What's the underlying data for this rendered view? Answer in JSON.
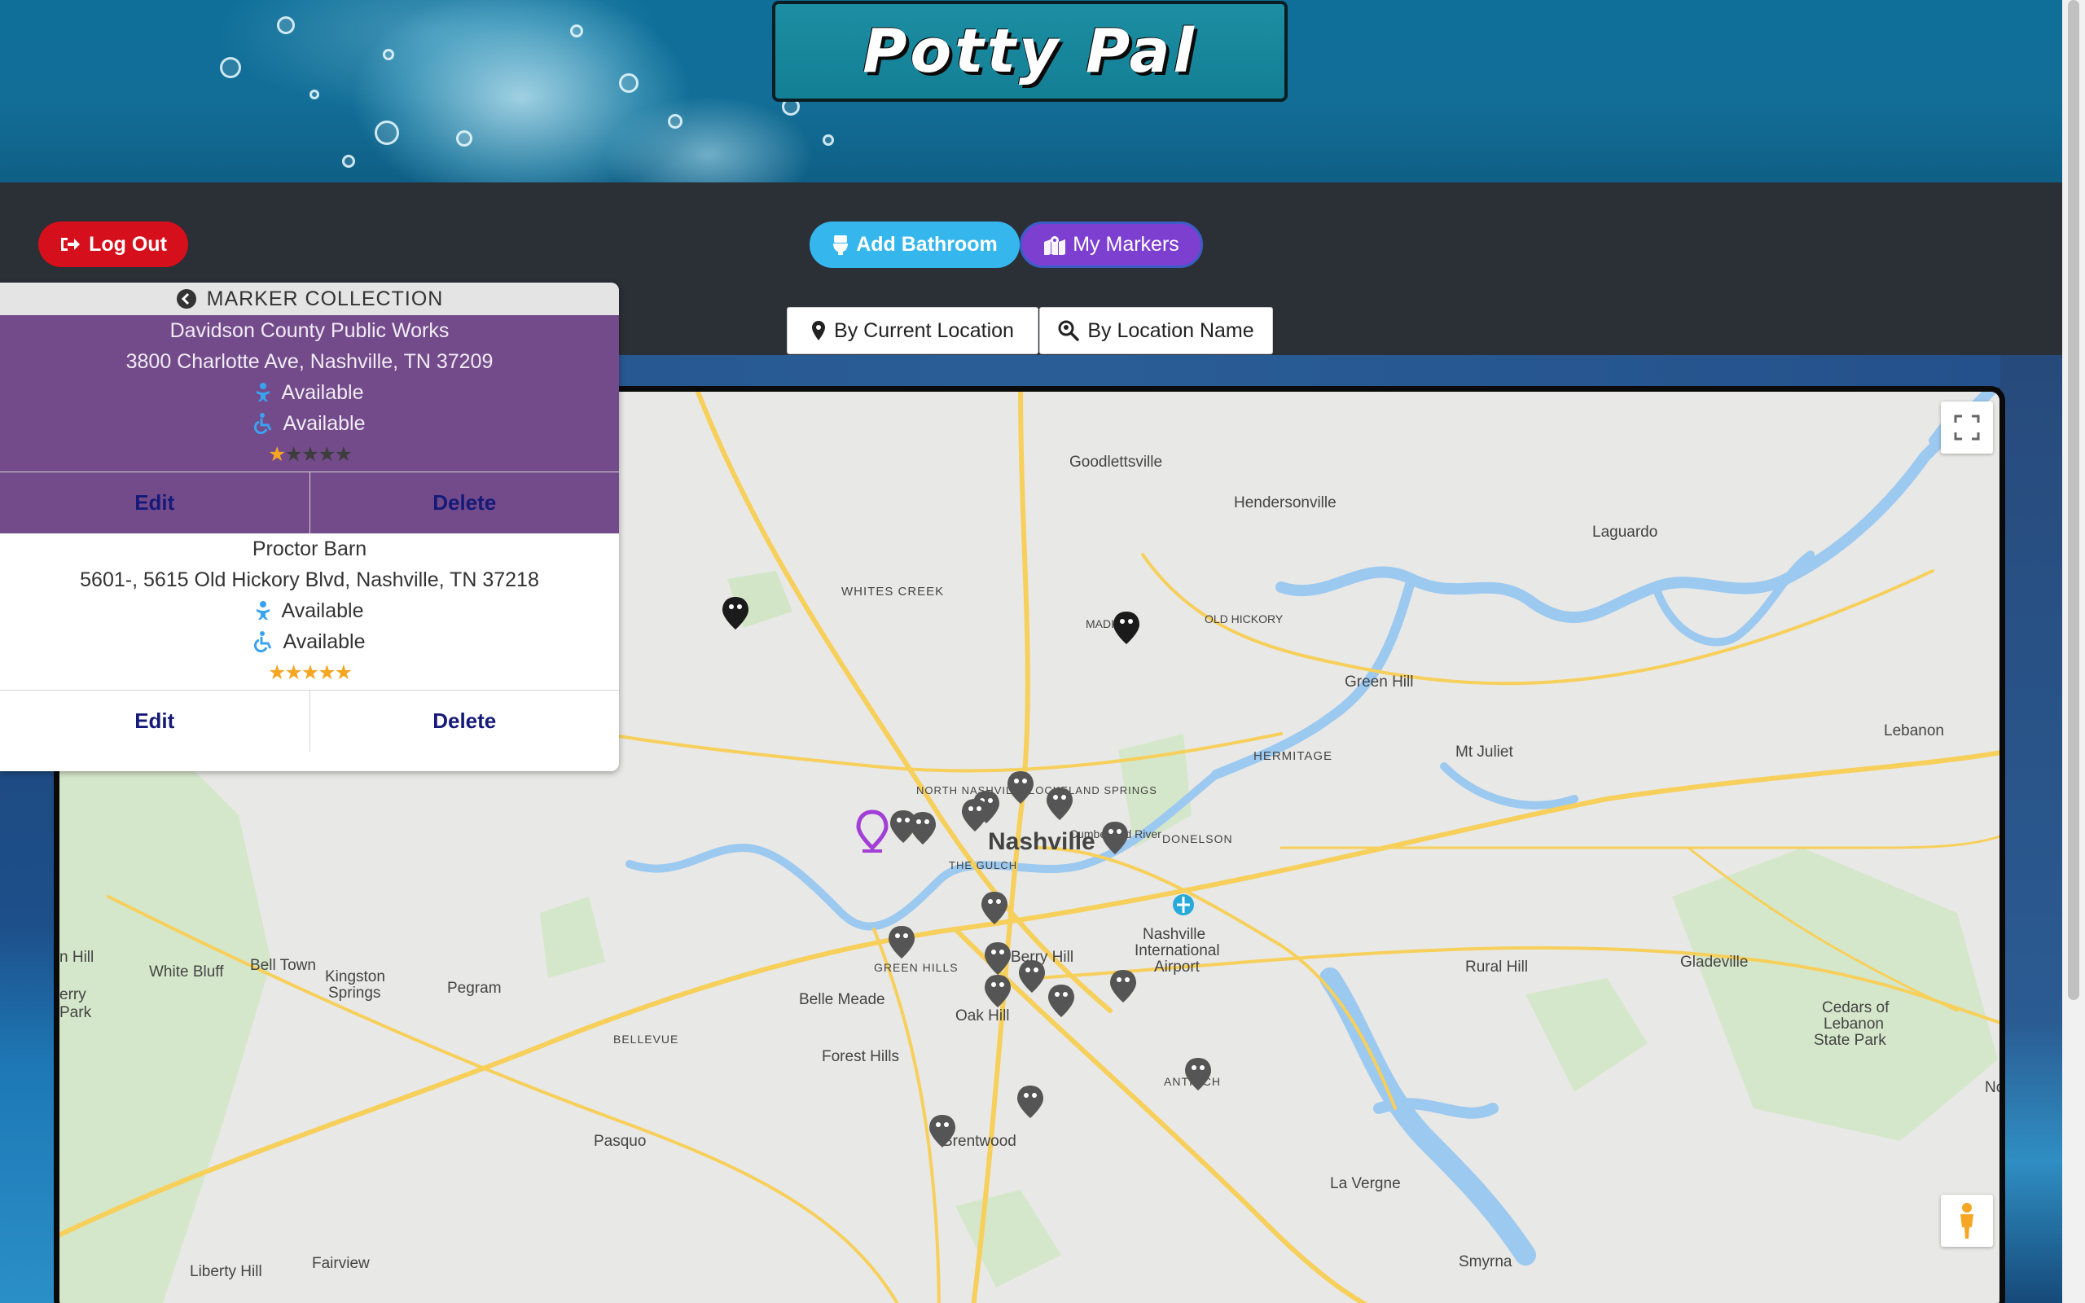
{
  "app": {
    "title": "Potty Pal"
  },
  "toolbar": {
    "logout_label": "Log Out",
    "add_bathroom_label": "Add Bathroom",
    "my_markers_label": "My Markers",
    "by_current_location_label": "By Current Location",
    "by_location_name_label": "By Location Name"
  },
  "panel": {
    "title": "MARKER COLLECTION",
    "markers": [
      {
        "name": "Davidson County Public Works",
        "address": "3800 Charlotte Ave, Nashville, TN 37209",
        "baby_changing": "Available",
        "accessible": "Available",
        "rating": 1,
        "rating_max": 5,
        "edit_label": "Edit",
        "delete_label": "Delete"
      },
      {
        "name": "Proctor Barn",
        "address": "5601-, 5615 Old Hickory Blvd, Nashville, TN 37218",
        "baby_changing": "Available",
        "accessible": "Available",
        "rating": 5,
        "rating_max": 5,
        "edit_label": "Edit",
        "delete_label": "Delete"
      }
    ]
  },
  "map": {
    "places": {
      "nashville": "Nashville",
      "goodlettsville": "Goodlettsville",
      "hendersonville": "Hendersonville",
      "laguardo": "Laguardo",
      "whites_creek": "WHITES CREEK",
      "madison": "MADISON",
      "old_hickory": "OLD HICKORY",
      "green_hill": "Green Hill",
      "hermitage": "HERMITAGE",
      "mt_juliet": "Mt Juliet",
      "lebanon": "Lebanon",
      "north_nashville": "NORTH NASHVILLE",
      "lockeland_springs": "LOCKELAND SPRINGS",
      "donelson": "DONELSON",
      "the_gulch": "THE GULCH",
      "cumberland_river": "Cumberland River",
      "airport_1": "Nashville",
      "airport_2": "International",
      "airport_3": "Airport",
      "rural_hill": "Rural Hill",
      "gladeville": "Gladeville",
      "cedars_1": "Cedars of",
      "cedars_2": "Lebanon",
      "cedars_3": "State Park",
      "white_bluff": "White Bluff",
      "bell_town": "Bell Town",
      "kingston_1": "Kingston",
      "kingston_2": "Springs",
      "pegram": "Pegram",
      "green_hills": "GREEN HILLS",
      "berry_hill": "Berry Hill",
      "belle_meade": "Belle Meade",
      "oak_hill": "Oak Hill",
      "bellevue": "BELLEVUE",
      "forest_hills": "Forest Hills",
      "antioch": "ANTIOCH",
      "pasquo": "Pasquo",
      "brentwood": "Brentwood",
      "la_vergne": "La Vergne",
      "liberty_hill": "Liberty Hill",
      "fairview": "Fairview",
      "smyrna": "Smyrna",
      "edge_hill": "n Hill",
      "edge_erry": "erry",
      "edge_park": "Park",
      "edge_no": "No"
    }
  }
}
